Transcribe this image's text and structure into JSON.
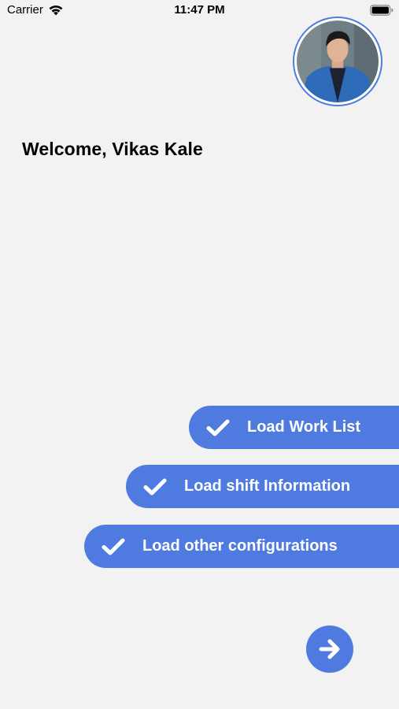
{
  "status_bar": {
    "carrier": "Carrier",
    "time": "11:47 PM",
    "wifi_icon": "wifi-icon",
    "battery_icon": "battery-icon"
  },
  "profile": {
    "avatar_icon": "user-avatar"
  },
  "welcome": {
    "text": "Welcome, Vikas Kale"
  },
  "tasks": [
    {
      "label": "Load Work List",
      "icon": "check-icon"
    },
    {
      "label": "Load shift Information",
      "icon": "check-icon"
    },
    {
      "label": "Load other configurations",
      "icon": "check-icon"
    }
  ],
  "next": {
    "icon": "arrow-right-icon"
  },
  "colors": {
    "accent": "#4f7be0",
    "background": "#f2f2f2",
    "text": "#000000"
  }
}
